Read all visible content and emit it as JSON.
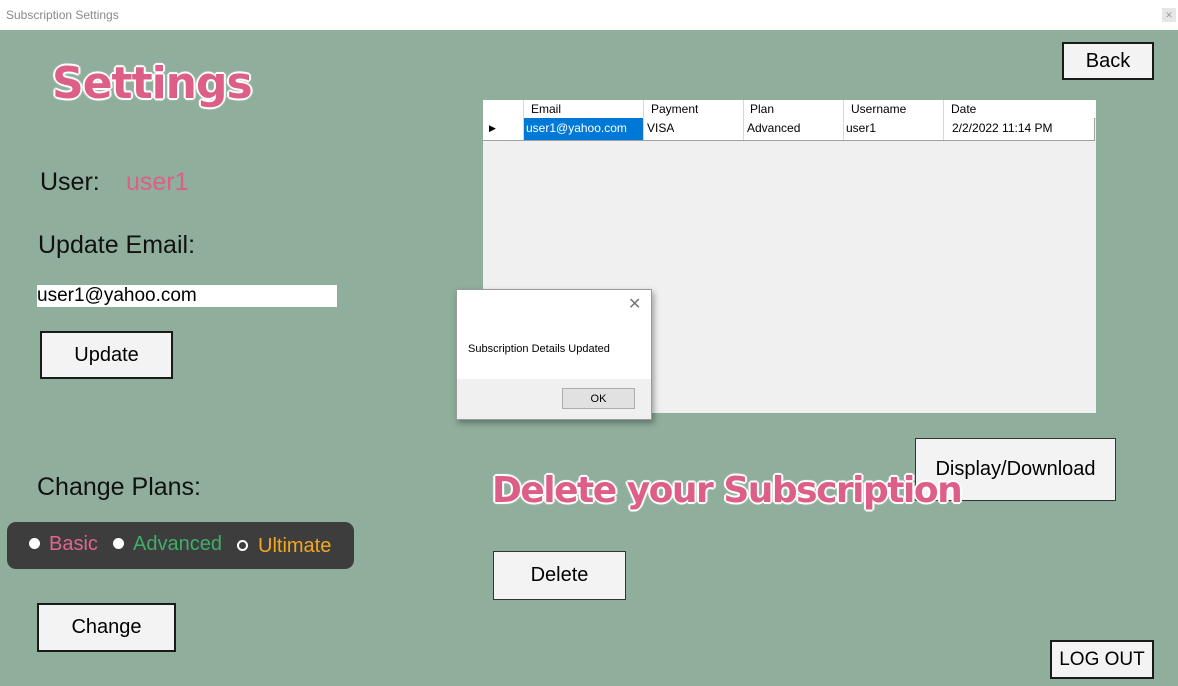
{
  "window": {
    "title": "Subscription Settings"
  },
  "header": {
    "title": "Settings"
  },
  "user": {
    "label": "User:",
    "value": "user1"
  },
  "update_email": {
    "label": "Update Email:",
    "value": "user1@yahoo.com",
    "button": "Update"
  },
  "plans": {
    "label": "Change Plans:",
    "options": [
      {
        "label": "Basic",
        "color": "#e0658f",
        "selected": true
      },
      {
        "label": "Advanced",
        "color": "#3fae6a",
        "selected": true
      },
      {
        "label": "Ultimate",
        "color": "#f5a623",
        "selected": false
      }
    ],
    "button": "Change"
  },
  "toolbar": {
    "back": "Back",
    "display_download": "Display/Download",
    "logout": "LOG OUT"
  },
  "delete_section": {
    "title": "Delete your Subscription",
    "button": "Delete"
  },
  "grid": {
    "columns": [
      "Email",
      "Payment",
      "Plan",
      "Username",
      "Date"
    ],
    "rows": [
      {
        "email": "user1@yahoo.com",
        "payment": "VISA",
        "plan": "Advanced",
        "username": "user1",
        "date": "2/2/2022 11:14 PM"
      }
    ]
  },
  "dialog": {
    "message": "Subscription Details Updated",
    "ok": "OK"
  },
  "colors": {
    "background": "#8fae9b",
    "accent": "#dd5f88",
    "selection": "#0078d7"
  }
}
